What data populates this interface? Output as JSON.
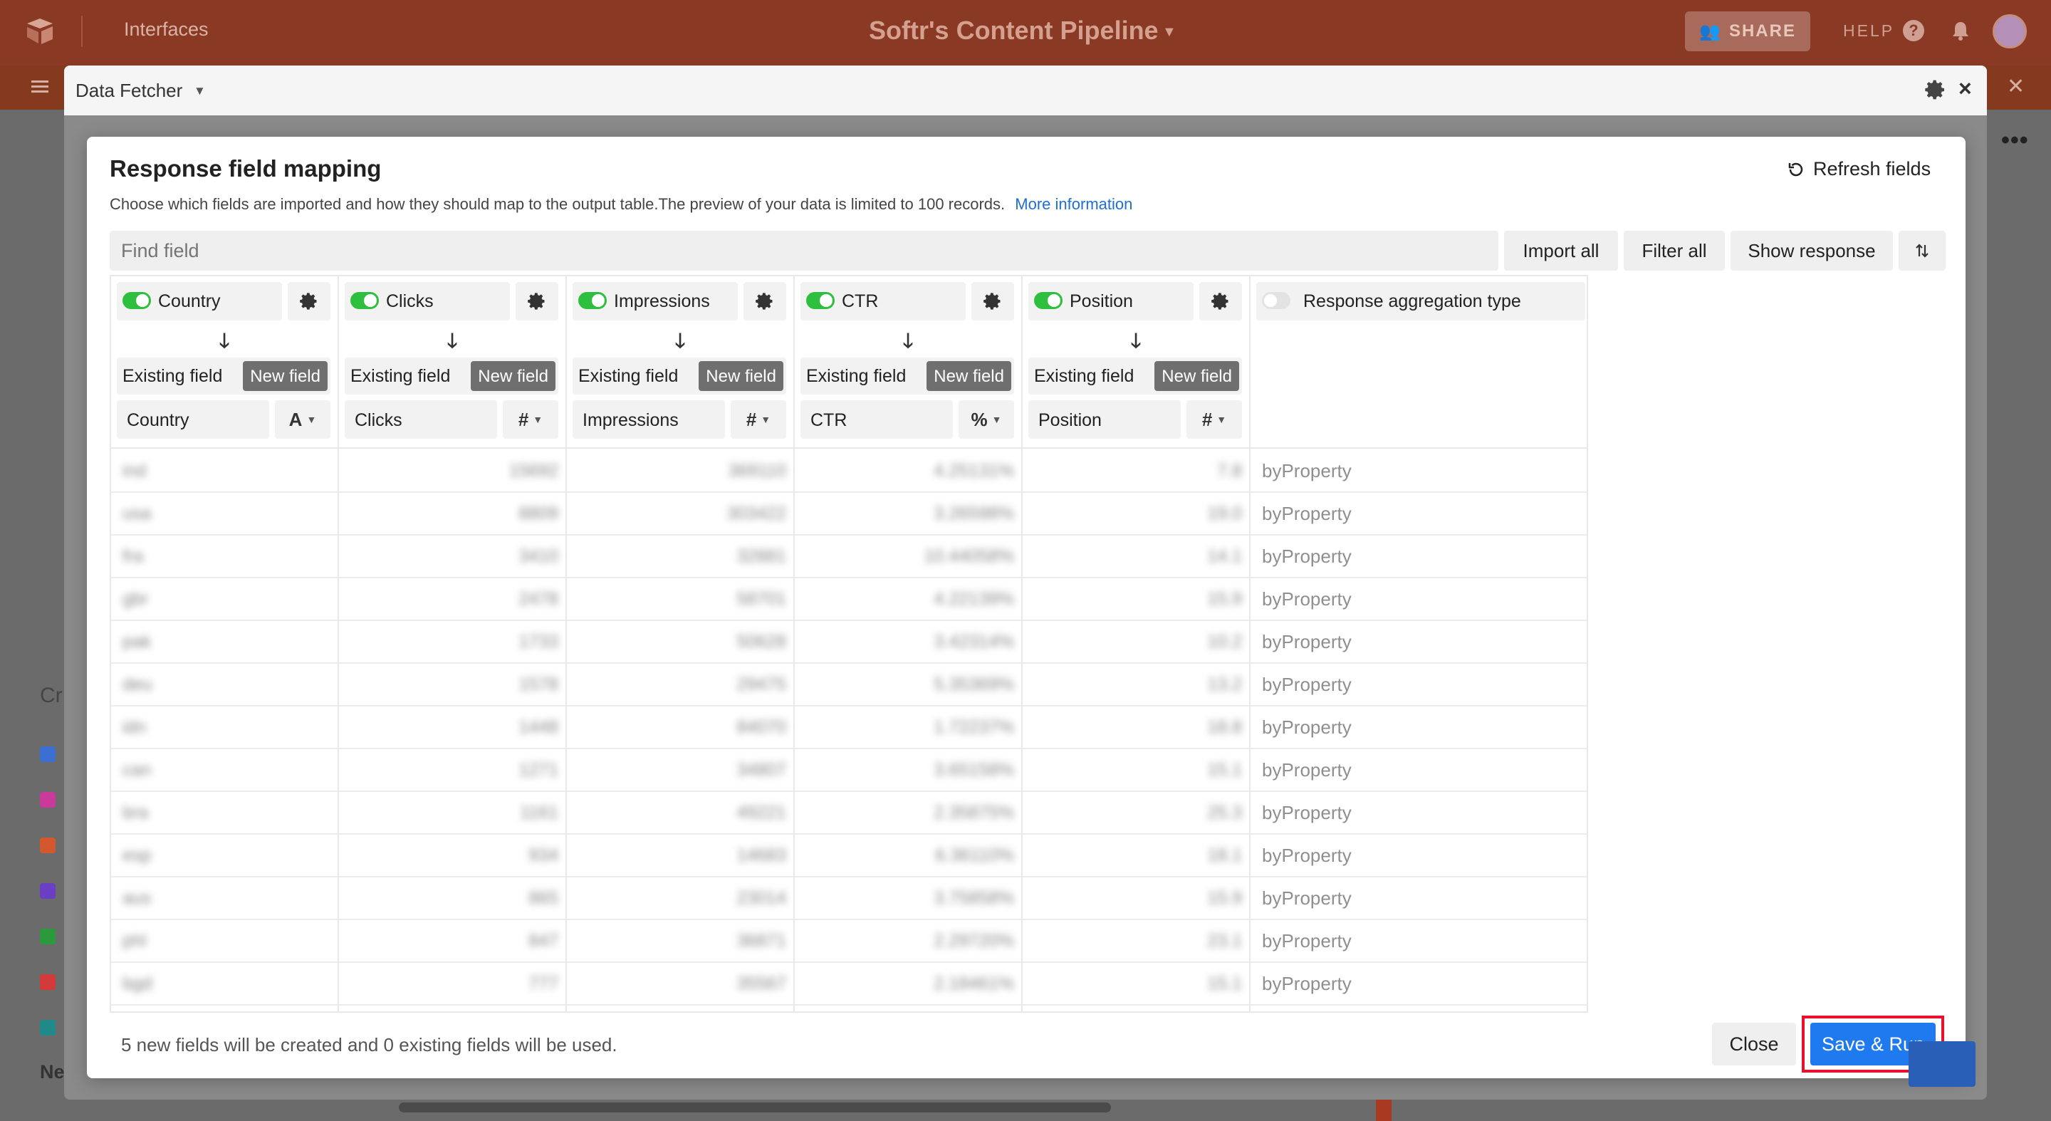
{
  "app": {
    "nav_label": "Interfaces",
    "base_title": "Softr's Content Pipeline",
    "share_label": "SHARE",
    "help_label": "HELP",
    "bg_side_text": "Cr",
    "bg_bottom_text": "Ne"
  },
  "fetcher": {
    "title": "Data Fetcher"
  },
  "modal": {
    "title": "Response field mapping",
    "refresh_label": "Refresh fields",
    "description": "Choose which fields are imported and how they should map to the output table.The preview of your data is limited to 100 records.",
    "more_info": "More information",
    "find_placeholder": "Find field",
    "toolbar": {
      "import_all": "Import all",
      "filter_all": "Filter all",
      "show_response": "Show response"
    },
    "existing_label": "Existing field",
    "new_label": "New field",
    "columns": [
      {
        "name": "Country",
        "output": "Country",
        "type_glyph": "A",
        "rows": [
          "ind",
          "usa",
          "fra",
          "gbr",
          "pak",
          "deu",
          "idn",
          "can",
          "bra",
          "esp",
          "aus",
          "phl",
          "bgd"
        ]
      },
      {
        "name": "Clicks",
        "output": "Clicks",
        "type_glyph": "#",
        "rows": [
          "15692",
          "8809",
          "3410",
          "2478",
          "1733",
          "1578",
          "1448",
          "1271",
          "1161",
          "934",
          "865",
          "847",
          "777"
        ]
      },
      {
        "name": "Impressions",
        "output": "Impressions",
        "type_glyph": "#",
        "rows": [
          "369110",
          "303422",
          "32881",
          "58701",
          "50628",
          "29475",
          "84070",
          "34807",
          "49221",
          "14683",
          "23014",
          "36871",
          "35567"
        ]
      },
      {
        "name": "CTR",
        "output": "CTR",
        "type_glyph": "%",
        "rows": [
          "4.25131%",
          "3.26598%",
          "10.44058%",
          "4.22139%",
          "3.42314%",
          "5.35369%",
          "1.72237%",
          "3.65158%",
          "2.35875%",
          "6.36110%",
          "3.75858%",
          "2.29720%",
          "2.18461%"
        ]
      },
      {
        "name": "Position",
        "output": "Position",
        "type_glyph": "#",
        "rows": [
          "7.8",
          "19.0",
          "14.1",
          "15.9",
          "10.2",
          "13.2",
          "18.8",
          "15.1",
          "25.3",
          "18.1",
          "15.9",
          "23.1",
          "15.1"
        ]
      }
    ],
    "aggregation": {
      "label": "Response aggregation type",
      "rows": [
        "byProperty",
        "byProperty",
        "byProperty",
        "byProperty",
        "byProperty",
        "byProperty",
        "byProperty",
        "byProperty",
        "byProperty",
        "byProperty",
        "byProperty",
        "byProperty",
        "byProperty"
      ]
    },
    "footer_note": "5 new fields will be created and 0 existing fields will be used.",
    "close_label": "Close",
    "run_label": "Save & Run"
  },
  "colors": {
    "topbar": "#8a3a24",
    "toggle_on": "#2fbf3f",
    "primary": "#1f7af0",
    "highlight": "#e8102a"
  }
}
